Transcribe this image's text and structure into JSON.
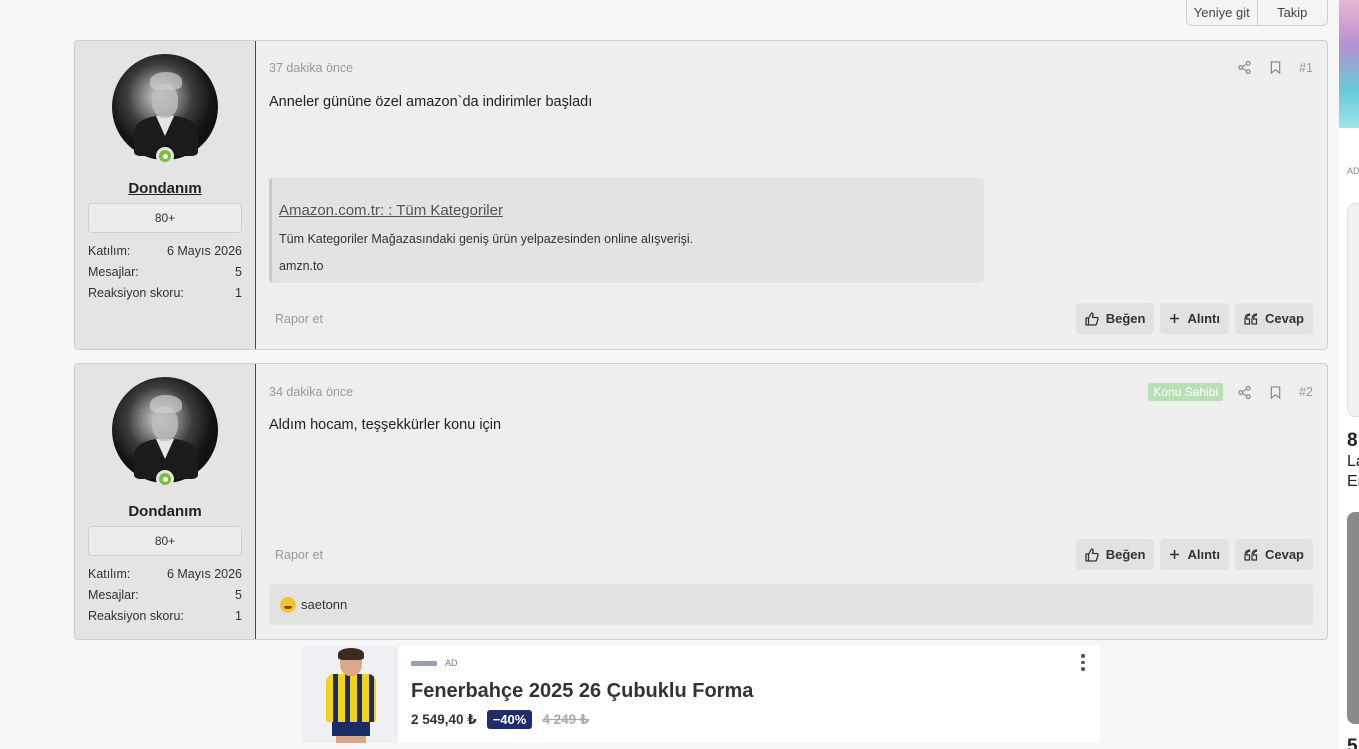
{
  "thread_controls": {
    "go_new": "Yeniye git",
    "follow": "Takip"
  },
  "posts": [
    {
      "user": {
        "name": "Dondanım",
        "rank": "80+",
        "stats": [
          {
            "label": "Katılım:",
            "value": "6 Mayıs 2026"
          },
          {
            "label": "Mesajlar:",
            "value": "5"
          },
          {
            "label": "Reaksiyon skoru:",
            "value": "1"
          }
        ]
      },
      "date": "37 dakika önce",
      "number": "#1",
      "body": "Anneler gününe özel amazon`da indirimler başladı",
      "unfurl": {
        "title": "Amazon.com.tr: : Tüm Kategoriler",
        "description": "Tüm Kategoriler Mağazasındaki geniş ürün yelpazesinden online alışverişi.",
        "domain": "amzn.to"
      },
      "actions": {
        "report": "Rapor et",
        "like": "Beğen",
        "quote": "Alıntı",
        "reply": "Cevap"
      }
    },
    {
      "user": {
        "name": "Dondanım",
        "rank": "80+",
        "stats": [
          {
            "label": "Katılım:",
            "value": "6 Mayıs 2026"
          },
          {
            "label": "Mesajlar:",
            "value": "5"
          },
          {
            "label": "Reaksiyon skoru:",
            "value": "1"
          }
        ]
      },
      "date": "34 dakika önce",
      "owner_badge": "Konu Sahibi",
      "number": "#2",
      "body": "Aldım hocam, teşşekkürler konu için",
      "actions": {
        "report": "Rapor et",
        "like": "Beğen",
        "quote": "Alıntı",
        "reply": "Cevap"
      },
      "reactions": {
        "user": "saetonn"
      }
    }
  ],
  "ad": {
    "tag": "AD",
    "title": "Fenerbahçe 2025 26 Çubuklu Forma",
    "price": "2 549,40 ₺",
    "discount": "−40%",
    "old_price": "4 249 ₺"
  },
  "sidebar_ad": {
    "tag": "AD",
    "t1": "8",
    "t2": "La",
    "t3": "Er",
    "t4": "5"
  },
  "colors": {
    "online": "#7cbd3a",
    "owner_badge": "#b9e0b4",
    "discount_badge": "#1f2d6b",
    "user_border": "#8b2b2b"
  }
}
